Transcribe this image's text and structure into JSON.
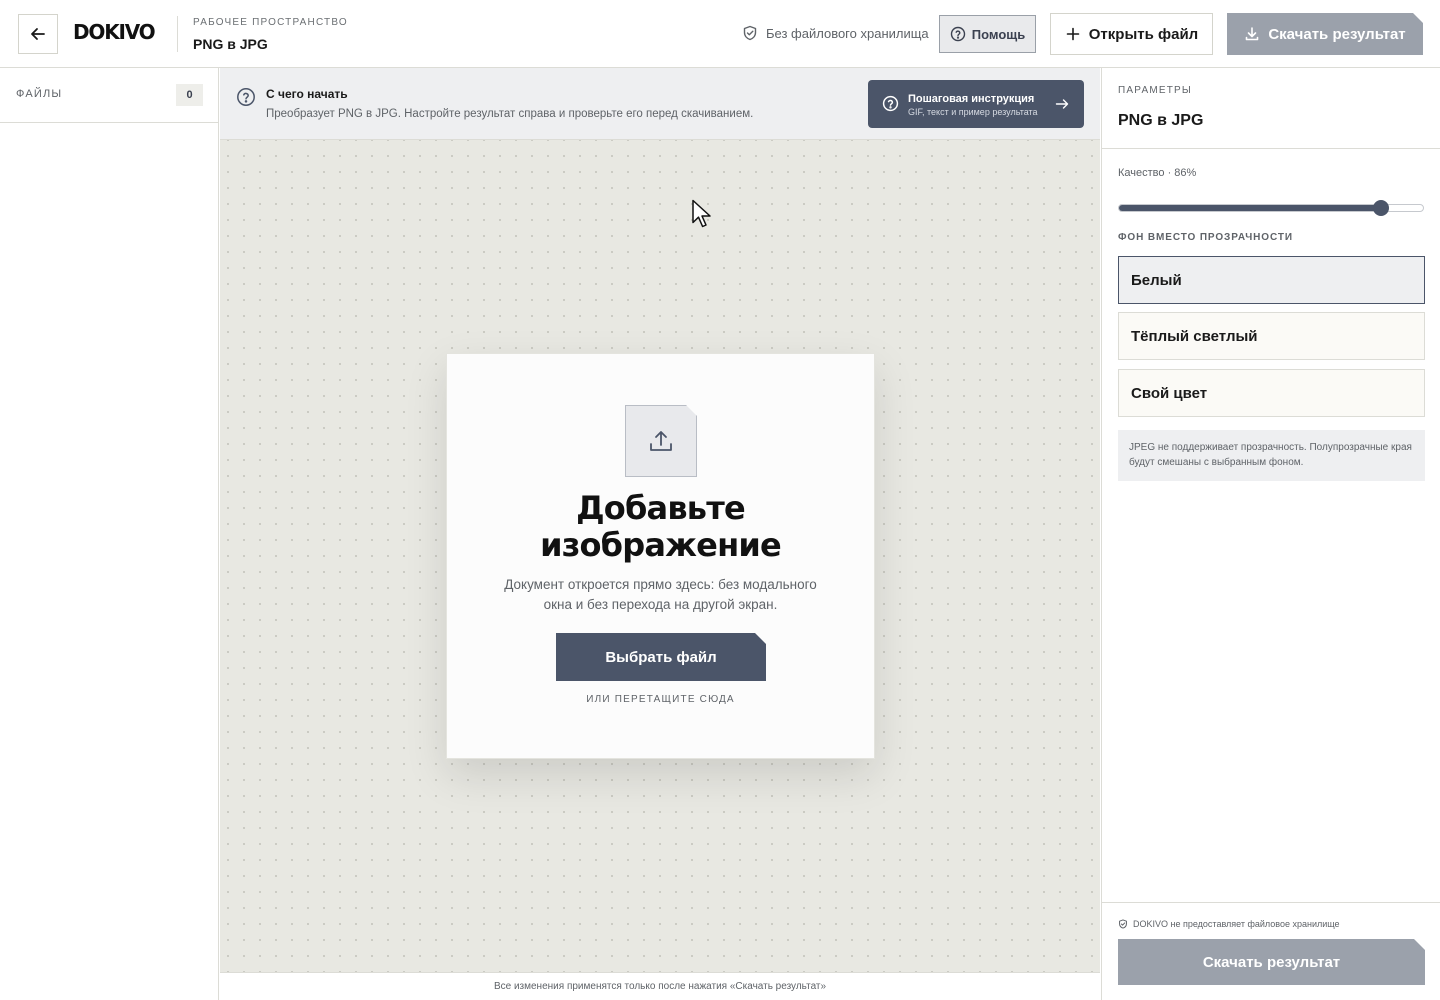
{
  "header": {
    "logo": "DOKIVO",
    "workspace_label": "РАБОЧЕЕ ПРОСТРАНСТВО",
    "workspace_title": "PNG в JPG",
    "storage_note": "Без файлового хранилища",
    "help_label": "Помощь",
    "open_label": "Открыть файл",
    "download_label": "Скачать результат"
  },
  "sidebar": {
    "files_label": "ФАЙЛЫ",
    "files_count": "0"
  },
  "banner": {
    "title": "С чего начать",
    "text": "Преобразует PNG в JPG. Настройте результат справа и проверьте его перед скачиванием.",
    "guide_title": "Пошаговая инструкция",
    "guide_subtitle": "GIF, текст и пример результата"
  },
  "upload": {
    "title_line1": "Добавьте",
    "title_line2": "изображение",
    "desc_line1": "Документ откроется прямо здесь: без модального",
    "desc_line2": "окна и без перехода на другой экран.",
    "choose_label": "Выбрать файл",
    "drop_hint": "ИЛИ ПЕРЕТАЩИТЕ СЮДА"
  },
  "footer": {
    "note": "Все изменения применятся только после нажатия «Скачать результат»"
  },
  "params": {
    "label": "ПАРАМЕТРЫ",
    "title": "PNG в JPG",
    "quality_label": "Качество · 86%",
    "quality_value": 0.86,
    "bg_label": "ФОН ВМЕСТО ПРОЗРАЧНОСТИ",
    "bg_options": [
      "Белый",
      "Тёплый светлый",
      "Свой цвет"
    ],
    "bg_selected": "Белый",
    "note": "JPEG не поддерживает прозрачность. Полупрозрачные края будут смешаны с выбранным фоном.",
    "privacy_note": "DOKIVO не предоставляет файловое хранилище",
    "download_label": "Скачать результат"
  },
  "icons": {
    "back": "arrow-left-icon",
    "shield": "shield-check-icon",
    "help": "question-circle-icon",
    "plus": "plus-icon",
    "download": "download-icon",
    "upload": "upload-icon",
    "arrow_right": "arrow-right-icon",
    "cursor": "mouse-pointer-icon"
  },
  "colors": {
    "accent": "#4b5569",
    "disabled_button": "#9ba1ab",
    "canvas": "#e8e8e2"
  }
}
